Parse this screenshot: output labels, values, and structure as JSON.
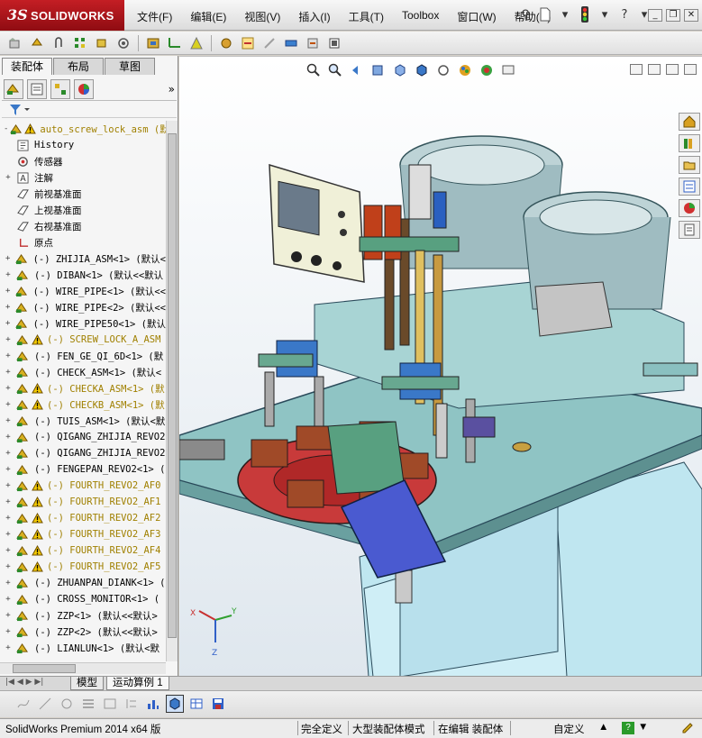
{
  "app": {
    "logo_mark": "3S",
    "logo_name": "SOLIDWORKS"
  },
  "menu": [
    "文件(F)",
    "编辑(E)",
    "视图(V)",
    "插入(I)",
    "工具(T)",
    "Toolbox",
    "窗口(W)",
    "帮助(H)"
  ],
  "left_tabs": [
    "装配体",
    "布局",
    "草图"
  ],
  "tree": [
    {
      "label": "auto_screw_lock_asm  (默",
      "icon": "assembly-icon",
      "warn": true,
      "expand": "-",
      "root": true
    },
    {
      "label": "History",
      "icon": "history-icon",
      "warn": false,
      "expand": ""
    },
    {
      "label": "传感器",
      "icon": "sensor-icon",
      "warn": false,
      "expand": ""
    },
    {
      "label": "注解",
      "icon": "annotation-icon",
      "warn": false,
      "expand": "+"
    },
    {
      "label": "前视基准面",
      "icon": "plane-icon",
      "warn": false,
      "expand": ""
    },
    {
      "label": "上视基准面",
      "icon": "plane-icon",
      "warn": false,
      "expand": ""
    },
    {
      "label": "右视基准面",
      "icon": "plane-icon",
      "warn": false,
      "expand": ""
    },
    {
      "label": "原点",
      "icon": "origin-icon",
      "warn": false,
      "expand": ""
    },
    {
      "label": "(-) ZHIJIA_ASM<1> (默认<",
      "icon": "subassembly-icon",
      "warn": false,
      "expand": "+"
    },
    {
      "label": "(-) DIBAN<1> (默认<<默认",
      "icon": "subassembly-icon",
      "warn": false,
      "expand": "+"
    },
    {
      "label": "(-) WIRE_PIPE<1> (默认<<",
      "icon": "subassembly-icon",
      "warn": false,
      "expand": "+"
    },
    {
      "label": "(-) WIRE_PIPE<2> (默认<<",
      "icon": "subassembly-icon",
      "warn": false,
      "expand": "+"
    },
    {
      "label": "(-) WIRE_PIPE50<1> (默认",
      "icon": "subassembly-icon",
      "warn": false,
      "expand": "+"
    },
    {
      "label": "(-) SCREW_LOCK_A_ASM",
      "icon": "subassembly-icon",
      "warn": true,
      "expand": "+"
    },
    {
      "label": "(-) FEN_GE_QI_6D<1> (默",
      "icon": "subassembly-icon",
      "warn": false,
      "expand": "+"
    },
    {
      "label": "(-) CHECK_ASM<1> (默认<",
      "icon": "subassembly-icon",
      "warn": false,
      "expand": "+"
    },
    {
      "label": "(-) CHECKA_ASM<1> (默",
      "icon": "subassembly-icon",
      "warn": true,
      "expand": "+"
    },
    {
      "label": "(-) CHECKB_ASM<1> (默",
      "icon": "subassembly-icon",
      "warn": true,
      "expand": "+"
    },
    {
      "label": "(-) TUIS_ASM<1> (默认<默",
      "icon": "subassembly-icon",
      "warn": false,
      "expand": "+"
    },
    {
      "label": "(-) QIGANG_ZHIJIA_REVO2",
      "icon": "subassembly-icon",
      "warn": false,
      "expand": "+"
    },
    {
      "label": "(-) QIGANG_ZHIJIA_REVO2",
      "icon": "subassembly-icon",
      "warn": false,
      "expand": "+"
    },
    {
      "label": "(-) FENGEPAN_REVO2<1> (",
      "icon": "subassembly-icon",
      "warn": false,
      "expand": "+"
    },
    {
      "label": "(-) FOURTH_REVO2_AF0",
      "icon": "subassembly-icon",
      "warn": true,
      "expand": "+"
    },
    {
      "label": "(-) FOURTH_REVO2_AF1",
      "icon": "subassembly-icon",
      "warn": true,
      "expand": "+"
    },
    {
      "label": "(-) FOURTH_REVO2_AF2",
      "icon": "subassembly-icon",
      "warn": true,
      "expand": "+"
    },
    {
      "label": "(-) FOURTH_REVO2_AF3",
      "icon": "subassembly-icon",
      "warn": true,
      "expand": "+"
    },
    {
      "label": "(-) FOURTH_REVO2_AF4",
      "icon": "subassembly-icon",
      "warn": true,
      "expand": "+"
    },
    {
      "label": "(-) FOURTH_REVO2_AF5",
      "icon": "subassembly-icon",
      "warn": true,
      "expand": "+"
    },
    {
      "label": "(-) ZHUANPAN_DIANK<1> (",
      "icon": "subassembly-icon",
      "warn": false,
      "expand": "+"
    },
    {
      "label": "(-) CROSS_MONITOR<1> (",
      "icon": "subassembly-icon",
      "warn": false,
      "expand": "+"
    },
    {
      "label": "(-) ZZP<1> (默认<<默认>",
      "icon": "subassembly-icon",
      "warn": false,
      "expand": "+"
    },
    {
      "label": "(-) ZZP<2> (默认<<默认>",
      "icon": "subassembly-icon",
      "warn": false,
      "expand": "+"
    },
    {
      "label": "(-) LIANLUN<1> (默认<默",
      "icon": "subassembly-icon",
      "warn": false,
      "expand": "+"
    }
  ],
  "bottom_tabs": [
    "模型",
    "运动算例 1"
  ],
  "status": {
    "app_version": "SolidWorks Premium 2014 x64 版",
    "definition": "完全定义",
    "mode": "大型装配体模式",
    "editing": "在编辑 装配体",
    "units": "自定义"
  },
  "triad": {
    "x": "X",
    "y": "Y",
    "z": "Z"
  }
}
